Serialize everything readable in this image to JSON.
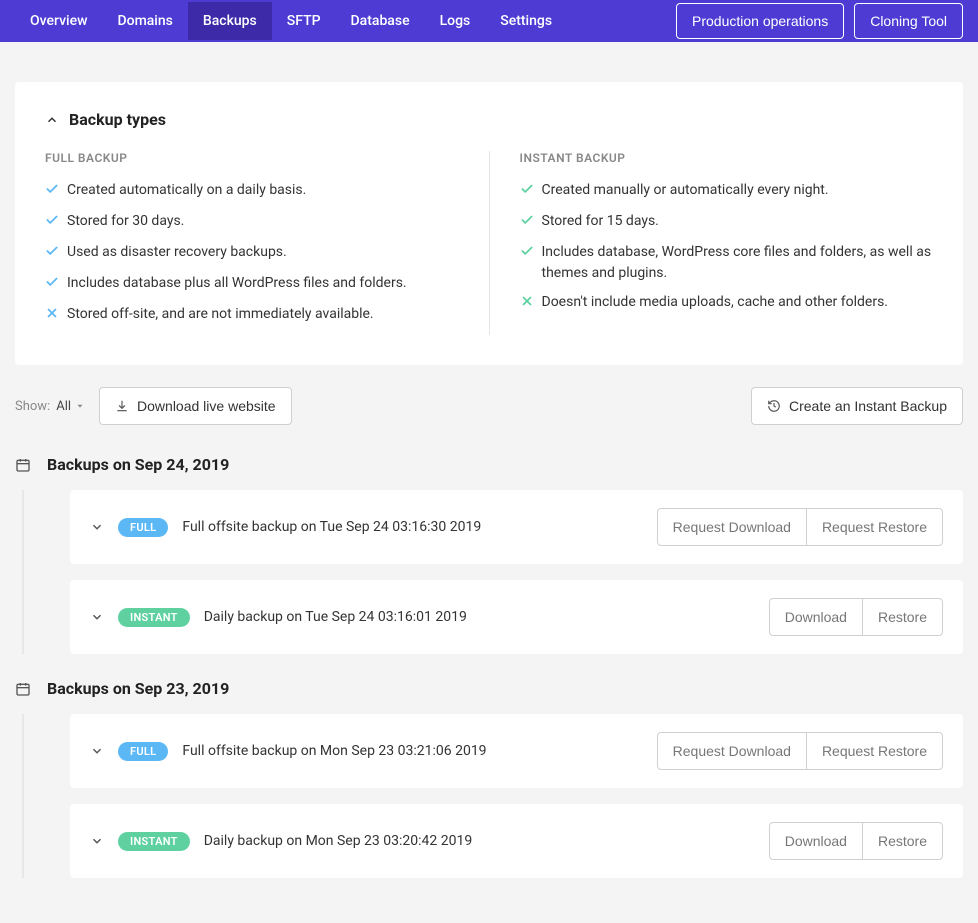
{
  "nav": {
    "tabs": [
      "Overview",
      "Domains",
      "Backups",
      "SFTP",
      "Database",
      "Logs",
      "Settings"
    ],
    "active": "Backups",
    "buttons": {
      "prod_ops": "Production operations",
      "cloning": "Cloning Tool"
    }
  },
  "card": {
    "title": "Backup types",
    "full": {
      "heading": "FULL BACKUP",
      "items": [
        {
          "ok": true,
          "text": "Created automatically on a daily basis."
        },
        {
          "ok": true,
          "text": "Stored for 30 days."
        },
        {
          "ok": true,
          "text": "Used as disaster recovery backups."
        },
        {
          "ok": true,
          "text": "Includes database plus all WordPress files and folders."
        },
        {
          "ok": false,
          "text": "Stored off-site, and are not immediately available."
        }
      ]
    },
    "instant": {
      "heading": "INSTANT BACKUP",
      "items": [
        {
          "ok": true,
          "text": "Created manually or automatically every night."
        },
        {
          "ok": true,
          "text": "Stored for 15 days."
        },
        {
          "ok": true,
          "text": "Includes database, WordPress core files and folders, as well as themes and plugins."
        },
        {
          "ok": false,
          "text": "Doesn't include media uploads, cache and other folders."
        }
      ]
    }
  },
  "toolbar": {
    "show_label": "Show:",
    "show_value": "All",
    "download_live": "Download live website",
    "create_instant": "Create an Instant Backup"
  },
  "groups": [
    {
      "title": "Backups on Sep 24, 2019",
      "rows": [
        {
          "type": "FULL",
          "label": "Full offsite backup on Tue Sep 24 03:16:30 2019",
          "btn1": "Request Download",
          "btn2": "Request Restore"
        },
        {
          "type": "INSTANT",
          "label": "Daily backup on Tue Sep 24 03:16:01 2019",
          "btn1": "Download",
          "btn2": "Restore"
        }
      ]
    },
    {
      "title": "Backups on Sep 23, 2019",
      "rows": [
        {
          "type": "FULL",
          "label": "Full offsite backup on Mon Sep 23 03:21:06 2019",
          "btn1": "Request Download",
          "btn2": "Request Restore"
        },
        {
          "type": "INSTANT",
          "label": "Daily backup on Mon Sep 23 03:20:42 2019",
          "btn1": "Download",
          "btn2": "Restore"
        }
      ]
    }
  ],
  "colors": {
    "brand": "#4e3bd4",
    "full": "#5bb8f4",
    "instant": "#5fd1a0"
  }
}
